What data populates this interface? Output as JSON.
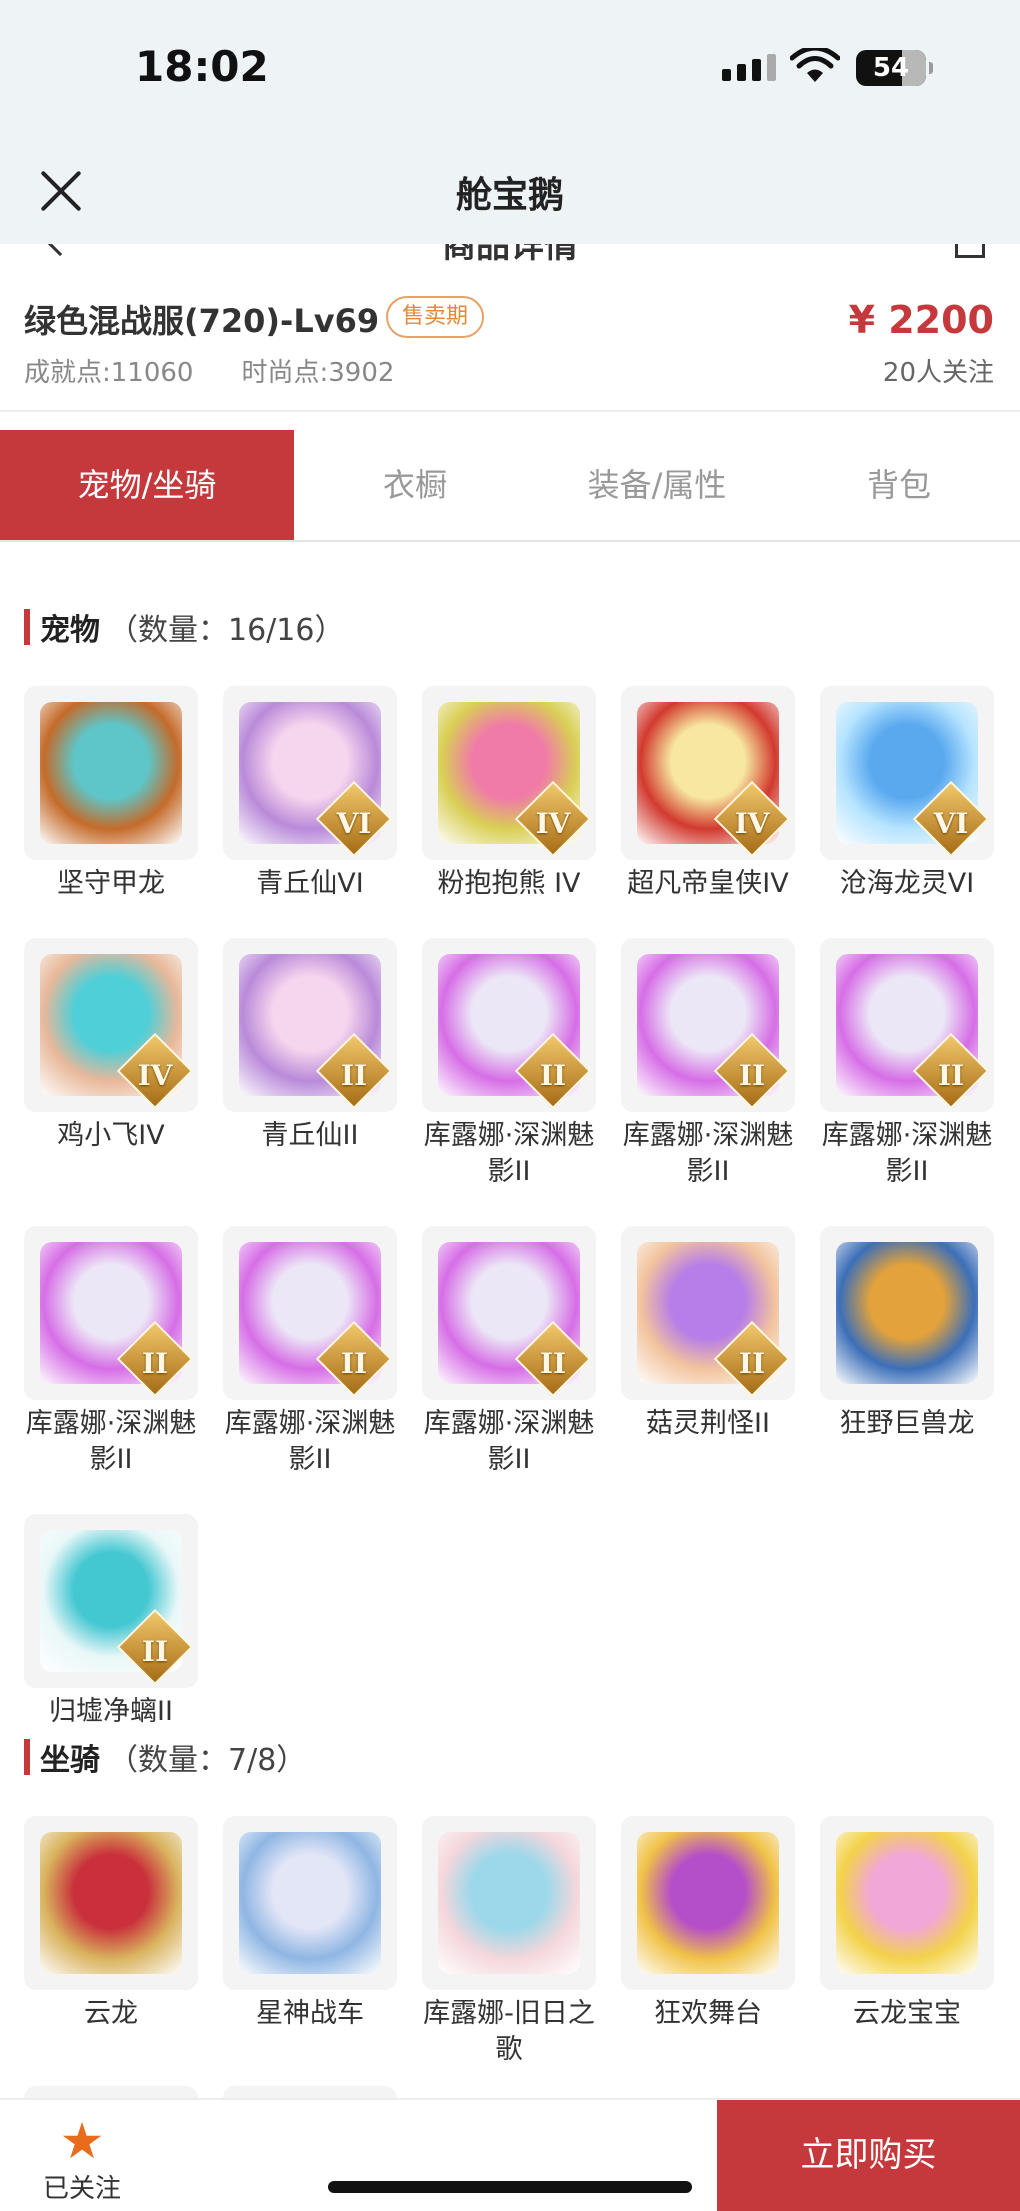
{
  "status_bar": {
    "time": "18:02",
    "battery": "54"
  },
  "nav": {
    "title": "舱宝鹅",
    "behind_title": "商品详情"
  },
  "product": {
    "name": "绿色混战服(720)-Lv69",
    "badge": "售卖期",
    "price": "¥ 2200",
    "achievement": "成就点:11060",
    "fashion": "时尚点:3902",
    "followers": "20人关注"
  },
  "tabs": [
    "宠物/坐骑",
    "衣橱",
    "装备/属性",
    "背包"
  ],
  "pets": {
    "title": "宠物",
    "count": "（数量：16/16）",
    "items": [
      {
        "label": "坚守甲龙",
        "grade": "",
        "c1": "#5ec6c9",
        "c2": "#c46b2a"
      },
      {
        "label": "青丘仙VI",
        "grade": "VI",
        "c1": "#f6d6ee",
        "c2": "#b98ad9"
      },
      {
        "label": "粉抱抱熊 IV",
        "grade": "IV",
        "c1": "#f07ba8",
        "c2": "#d9cf55"
      },
      {
        "label": "超凡帝皇侠IV",
        "grade": "IV",
        "c1": "#f7e7a0",
        "c2": "#d23a2f"
      },
      {
        "label": "沧海龙灵VI",
        "grade": "VI",
        "c1": "#5aa9ef",
        "c2": "#b6e4ff"
      },
      {
        "label": "鸡小飞IV",
        "grade": "IV",
        "c1": "#4fcfd8",
        "c2": "#e8b89a"
      },
      {
        "label": "青丘仙II",
        "grade": "II",
        "c1": "#f6d6ee",
        "c2": "#b98ad9"
      },
      {
        "label": "库露娜·深渊魅影II",
        "grade": "II",
        "c1": "#ece7f6",
        "c2": "#d66ee6"
      },
      {
        "label": "库露娜·深渊魅影II",
        "grade": "II",
        "c1": "#ece7f6",
        "c2": "#d66ee6"
      },
      {
        "label": "库露娜·深渊魅影II",
        "grade": "II",
        "c1": "#ece7f6",
        "c2": "#d66ee6"
      },
      {
        "label": "库露娜·深渊魅影II",
        "grade": "II",
        "c1": "#ece7f6",
        "c2": "#d66ee6"
      },
      {
        "label": "库露娜·深渊魅影II",
        "grade": "II",
        "c1": "#ece7f6",
        "c2": "#d66ee6"
      },
      {
        "label": "库露娜·深渊魅影II",
        "grade": "II",
        "c1": "#ece7f6",
        "c2": "#d66ee6"
      },
      {
        "label": "菇灵荆怪II",
        "grade": "II",
        "c1": "#b77de8",
        "c2": "#f2c49e"
      },
      {
        "label": "狂野巨兽龙",
        "grade": "",
        "c1": "#e3a23b",
        "c2": "#3c6fb8"
      },
      {
        "label": "归墟净螭II",
        "grade": "II",
        "c1": "#43c7d1",
        "c2": "#e9f7f8"
      }
    ]
  },
  "mounts": {
    "title": "坐骑",
    "count": "（数量：7/8）",
    "items": [
      {
        "label": "云龙",
        "grade": "",
        "c1": "#c9303b",
        "c2": "#d9b35e"
      },
      {
        "label": "星神战车",
        "grade": "",
        "c1": "#e3e6f7",
        "c2": "#8fb6e3"
      },
      {
        "label": "库露娜-旧日之歌",
        "grade": "",
        "c1": "#9ad8ea",
        "c2": "#f4d7dc"
      },
      {
        "label": "狂欢舞台",
        "grade": "",
        "c1": "#b54ec9",
        "c2": "#f0c247"
      },
      {
        "label": "云龙宝宝",
        "grade": "",
        "c1": "#f1a7d8",
        "c2": "#f3d24a"
      }
    ]
  },
  "bottom": {
    "fav_label": "已关注",
    "fav_icon": "star-icon",
    "buy_label": "立即购买"
  },
  "colors": {
    "accent": "#c5383b",
    "badge": "#e08a3c",
    "star": "#e96c1c"
  }
}
